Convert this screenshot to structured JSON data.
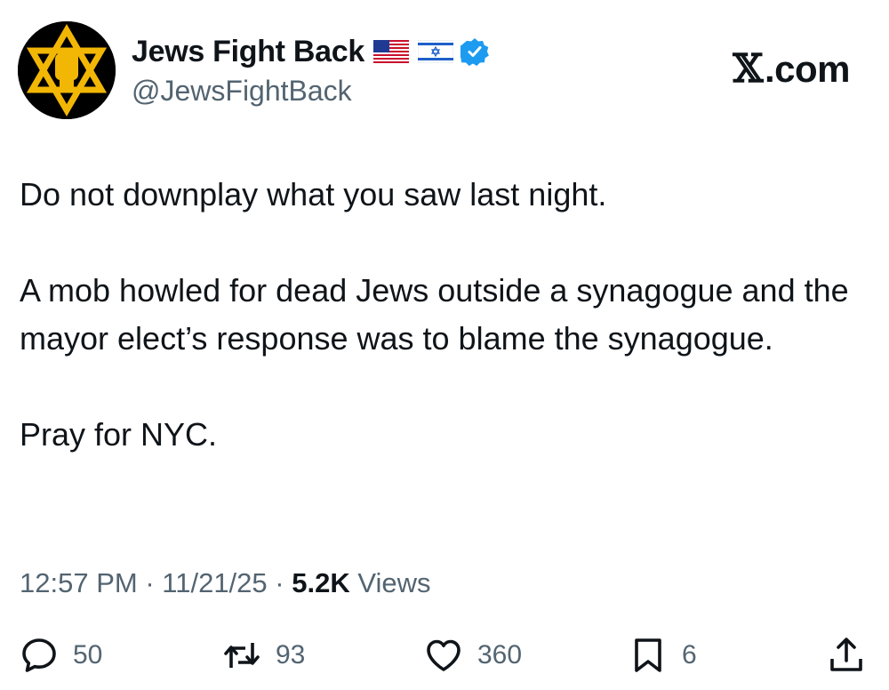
{
  "author": {
    "display_name": "Jews Fight Back",
    "handle": "@JewsFightBack",
    "flags": [
      "us-flag-icon",
      "israel-flag-icon"
    ],
    "verified": true
  },
  "brand": {
    "label": ".com",
    "logo": "x-logo-icon"
  },
  "tweet": {
    "paragraphs": [
      "Do not downplay what you saw last night.",
      "A mob howled for dead Jews outside a synagogue and the mayor elect’s response was to blame the synagogue.",
      "Pray for NYC."
    ]
  },
  "meta": {
    "time": "12:57 PM",
    "separator": "·",
    "date": "11/21/25",
    "views_count": "5.2K",
    "views_label": "Views"
  },
  "actions": {
    "replies": "50",
    "reposts": "93",
    "likes": "360",
    "bookmarks": "6"
  },
  "colors": {
    "text": "#0f1419",
    "secondary": "#536471",
    "verified": "#1d9bf0",
    "avatar_gold": "#f2b705"
  }
}
